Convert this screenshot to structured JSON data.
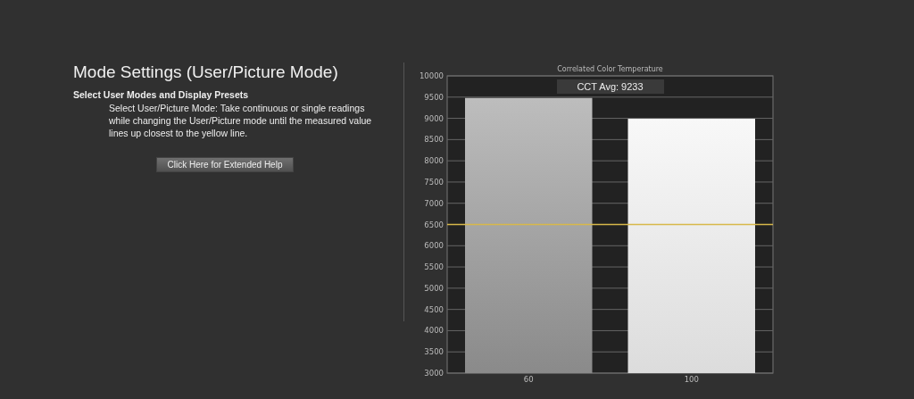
{
  "panel": {
    "title": "Mode Settings (User/Picture Mode)",
    "subtitle": "Select User Modes and Display Presets",
    "description": "Select User/Picture Mode: Take continuous or single readings while changing the User/Picture mode until the measured value lines up closest to the yellow line.",
    "help_button": "Click Here for Extended Help"
  },
  "chart": {
    "chart_data": {
      "type": "bar",
      "title": "Correlated Color Temperature",
      "categories": [
        "60",
        "100"
      ],
      "values": [
        9480,
        8990
      ],
      "ylim": [
        3000,
        10000
      ],
      "yticks": [
        3000,
        3500,
        4000,
        4500,
        5000,
        5500,
        6000,
        6500,
        7000,
        7500,
        8000,
        8500,
        9000,
        9500,
        10000
      ],
      "grid": true,
      "ref_lines": [
        {
          "axis": "y",
          "value": 6500,
          "color": "#d8b84a"
        }
      ],
      "annotations": [
        {
          "text": "CCT Avg: 9233"
        }
      ]
    }
  }
}
